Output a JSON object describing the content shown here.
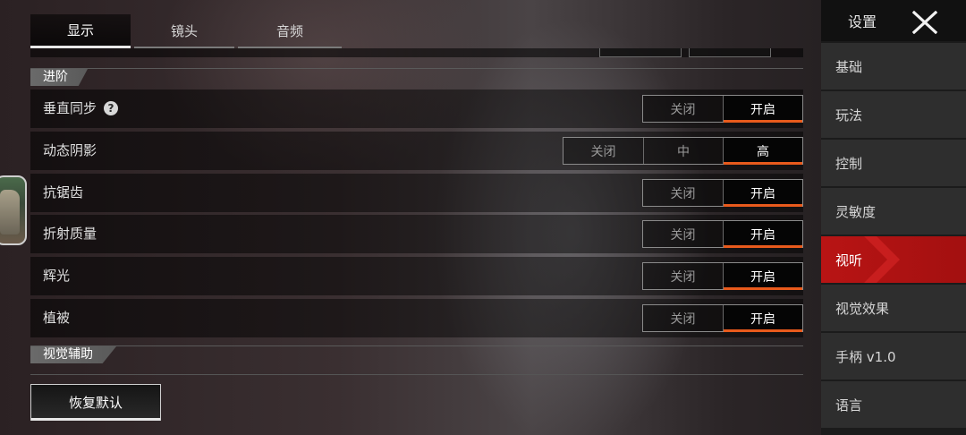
{
  "tabs": [
    {
      "label": "显示",
      "active": true
    },
    {
      "label": "镜头",
      "active": false
    },
    {
      "label": "音频",
      "active": false
    }
  ],
  "sections": {
    "advanced": "进阶",
    "visual_assist": "视觉辅助"
  },
  "rows": [
    {
      "label": "垂直同步",
      "help_icon": true,
      "options": [
        "关闭",
        "开启"
      ],
      "selected": "开启"
    },
    {
      "label": "动态阴影",
      "options": [
        "关闭",
        "中",
        "高"
      ],
      "selected": "高"
    },
    {
      "label": "抗锯齿",
      "options": [
        "关闭",
        "开启"
      ],
      "selected": "开启"
    },
    {
      "label": "折射质量",
      "options": [
        "关闭",
        "开启"
      ],
      "selected": "开启"
    },
    {
      "label": "辉光",
      "options": [
        "关闭",
        "开启"
      ],
      "selected": "开启"
    },
    {
      "label": "植被",
      "options": [
        "关闭",
        "开启"
      ],
      "selected": "开启"
    }
  ],
  "help_icon_glyph": "?",
  "reset_button": "恢复默认",
  "menu": {
    "title": "设置",
    "close_icon": "close-x-icon",
    "items": [
      {
        "label": "基础",
        "active": false
      },
      {
        "label": "玩法",
        "active": false
      },
      {
        "label": "控制",
        "active": false
      },
      {
        "label": "灵敏度",
        "active": false
      },
      {
        "label": "视听",
        "active": true
      },
      {
        "label": "视觉效果",
        "active": false
      },
      {
        "label": "手柄 v1.0",
        "active": false
      },
      {
        "label": "语言",
        "active": false
      }
    ]
  },
  "colors": {
    "accent_orange": "#e85a1c",
    "active_menu_red": "#b81414"
  }
}
